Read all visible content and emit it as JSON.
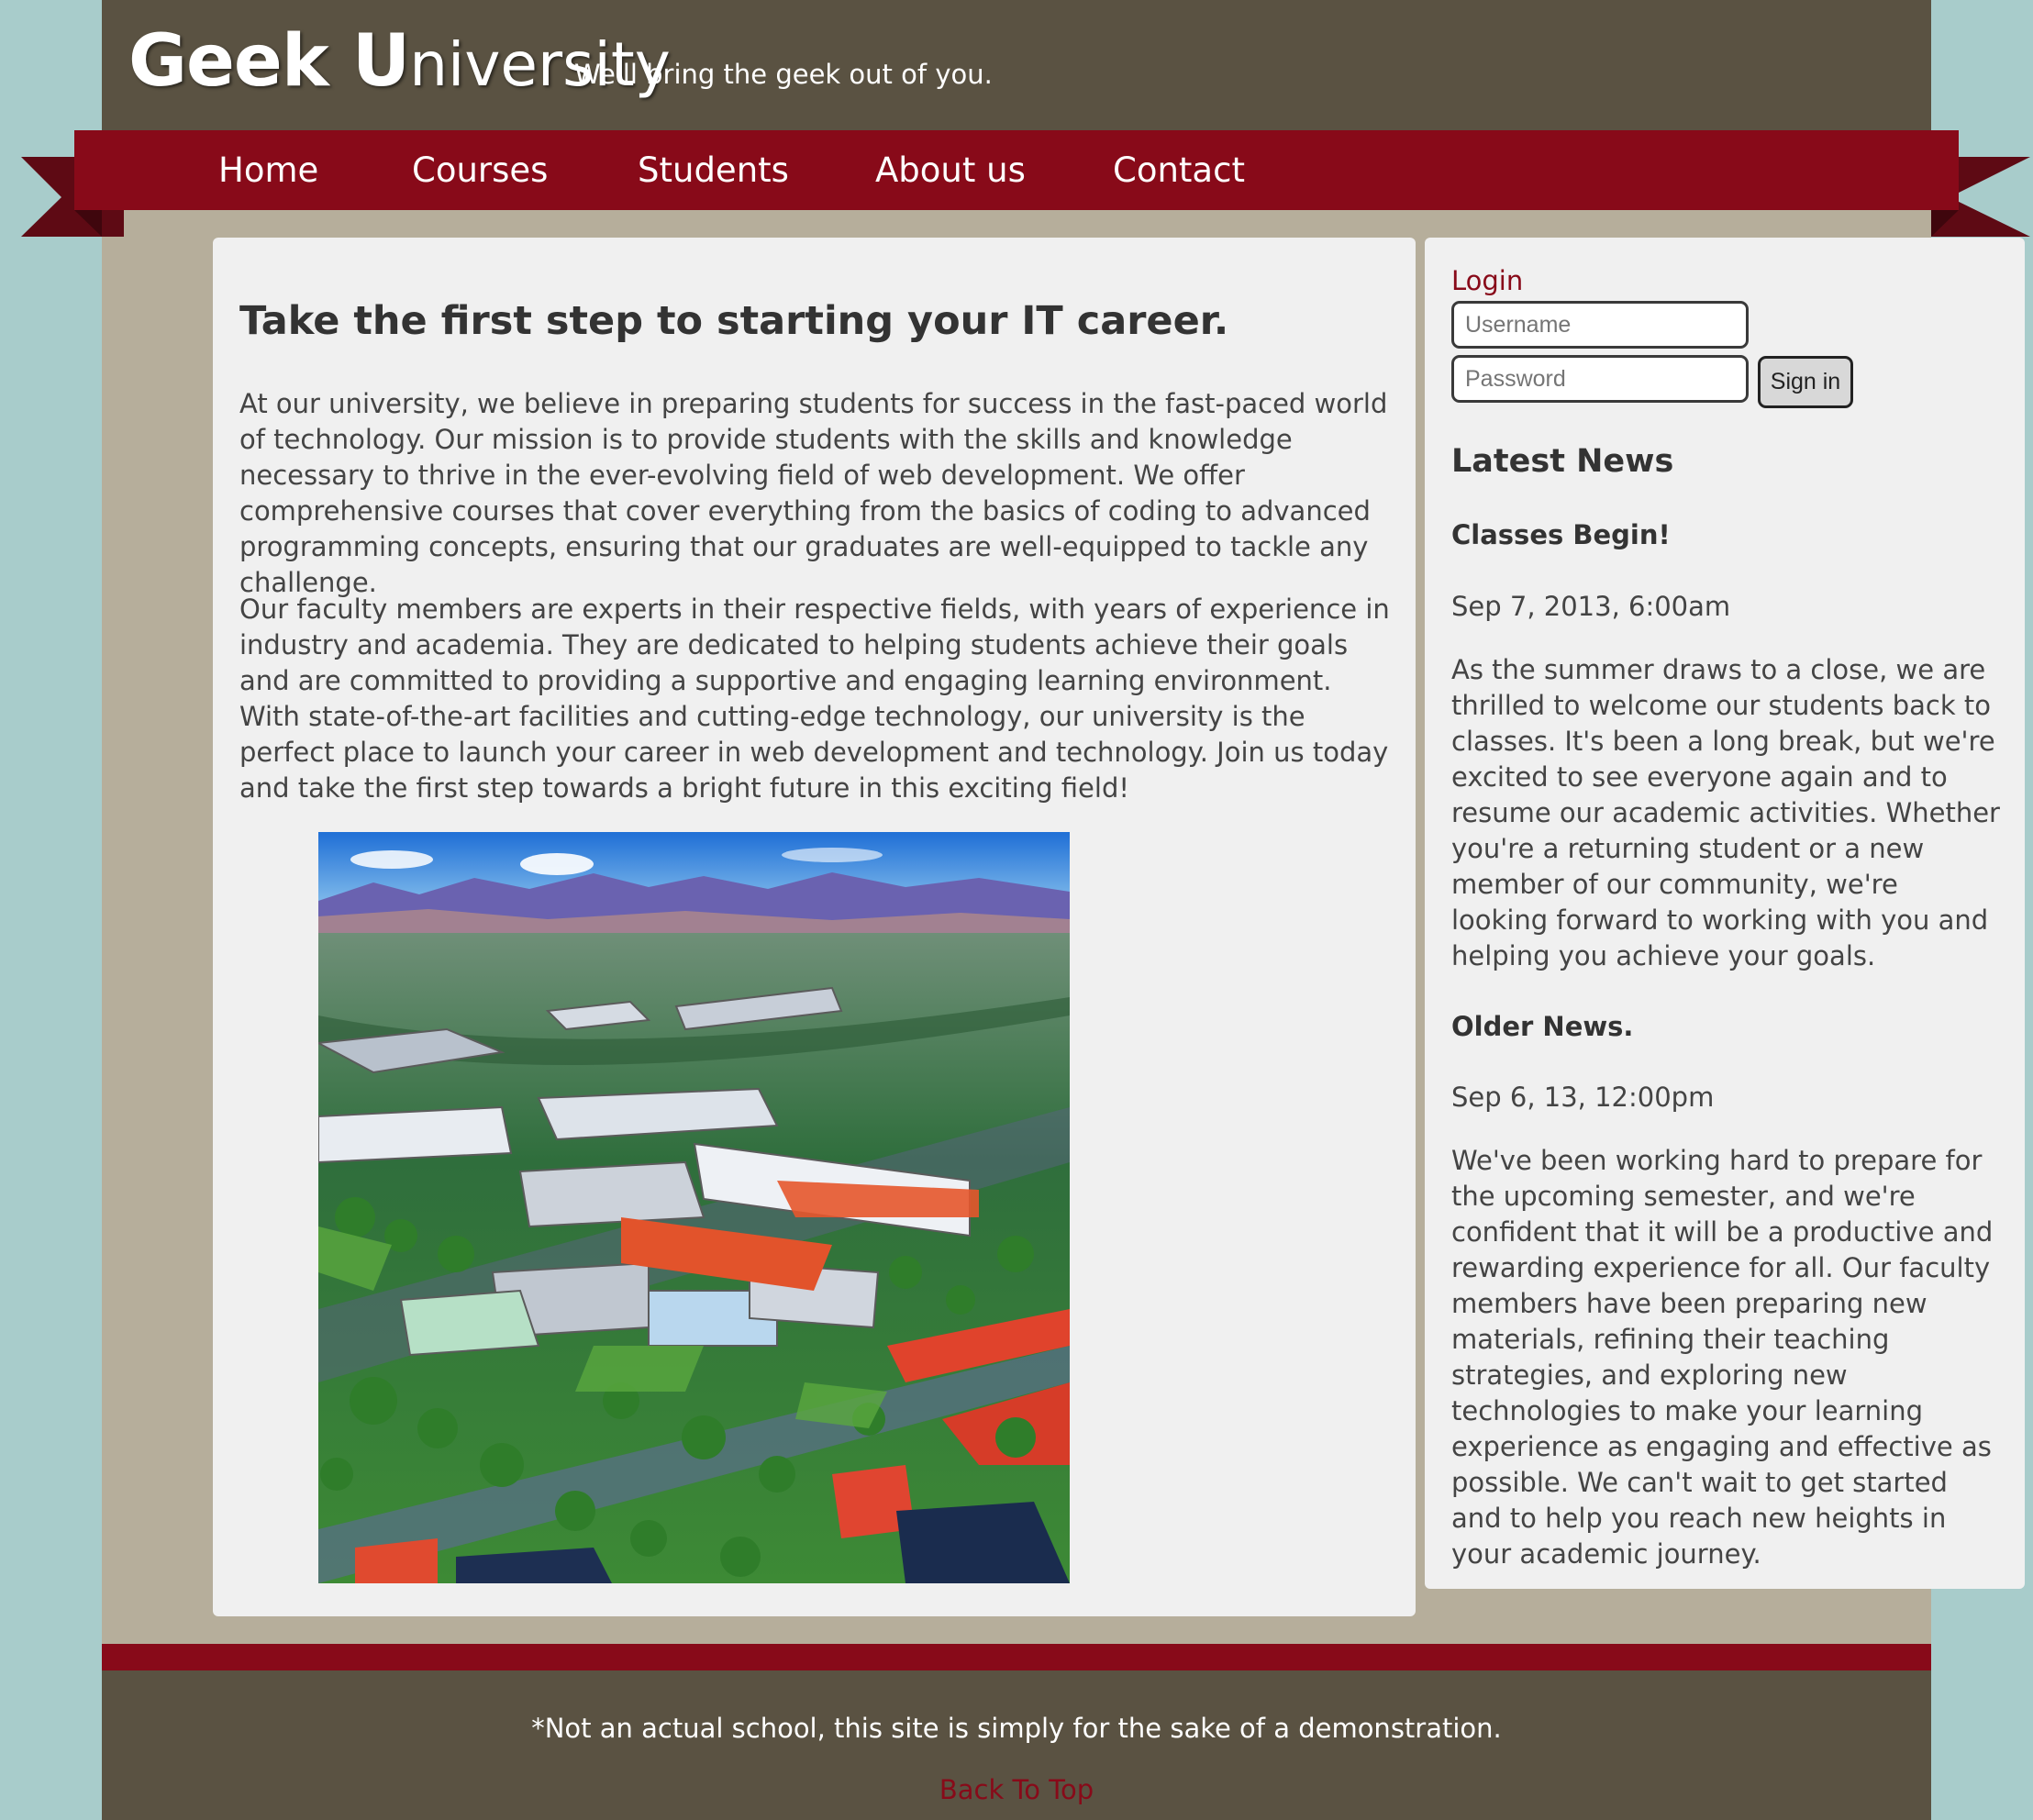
{
  "header": {
    "logo": {
      "part1": "Geek ",
      "part2": "U",
      "part3": "niversity"
    },
    "tagline": "We'll bring the geek out of you."
  },
  "nav": {
    "items": [
      {
        "label": "Home"
      },
      {
        "label": "Courses"
      },
      {
        "label": "Students"
      },
      {
        "label": "About us"
      },
      {
        "label": "Contact"
      }
    ]
  },
  "main": {
    "heading": "Take the first step to starting your IT career.",
    "paragraphs": [
      "At our university, we believe in preparing students for success in the fast-paced world of technology. Our mission is to provide students with the skills and knowledge necessary to thrive in the ever-evolving field of web development. We offer comprehensive courses that cover everything from the basics of coding to advanced programming concepts, ensuring that our graduates are well-equipped to tackle any challenge.",
      "Our faculty members are experts in their respective fields, with years of experience in industry and academia. They are dedicated to helping students achieve their goals and are committed to providing a supportive and engaging learning environment. With state-of-the-art facilities and cutting-edge technology, our university is the perfect place to launch your career in web development and technology. Join us today and take the first step towards a bright future in this exciting field!"
    ]
  },
  "login": {
    "label": "Login",
    "username_placeholder": "Username",
    "password_placeholder": "Password",
    "button_label": "Sign in"
  },
  "news": {
    "heading": "Latest News",
    "items": [
      {
        "title": "Classes Begin!",
        "date": "Sep 7, 2013, 6:00am",
        "body": "As the summer draws to a close, we are thrilled to welcome our students back to classes. It's been a long break, but we're excited to see everyone again and to resume our academic activities. Whether you're a returning student or a new member of our community, we're looking forward to working with you and helping you achieve your goals."
      },
      {
        "title": "Older News.",
        "date": "Sep 6, 13, 12:00pm",
        "body": "We've been working hard to prepare for the upcoming semester, and we're confident that it will be a productive and rewarding experience for all. Our faculty members have been preparing new materials, refining their teaching strategies, and exploring new technologies to make your learning experience as engaging and effective as possible. We can't wait to get started and to help you reach new heights in your academic journey."
      }
    ]
  },
  "footer": {
    "disclaimer": "*Not an actual school, this site is simply for the sake of a demonstration.",
    "back_to_top": "Back To Top"
  },
  "colors": {
    "header_bg": "#5a5242",
    "nav_bg": "#880a19",
    "page_bg": "#a8cccb",
    "content_bg": "#b6ae9b",
    "panel_bg": "#f0f0f0",
    "accent": "#880a19"
  }
}
